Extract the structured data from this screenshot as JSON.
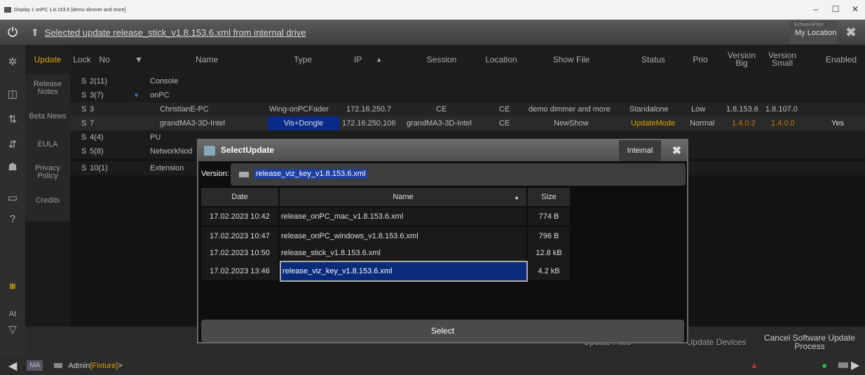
{
  "window": {
    "title": "Display 1 onPC 1.8.153.6 [demo dimmer and more]",
    "minimize": "–",
    "maximize": "☐",
    "close": "✕"
  },
  "topbar": {
    "message": "Selected update release_stick_v1.8.153.6.xml from internal drive",
    "softwarefilter_label": "SoftwareFilter",
    "softwarefilter_value": "My Location",
    "close_icon": "close-icon"
  },
  "tabs": [
    {
      "label": "Update",
      "active": true
    },
    {
      "label": "Release Notes"
    },
    {
      "label": "Beta News"
    },
    {
      "label": "EULA"
    },
    {
      "label": "Privacy Policy"
    },
    {
      "label": "Credits"
    }
  ],
  "table": {
    "headers": {
      "lock": "Lock",
      "no": "No",
      "name": "Name",
      "type": "Type",
      "ip": "IP",
      "session": "Session",
      "location": "Location",
      "showfile": "Show File",
      "status": "Status",
      "prio": "Prio",
      "version_big": "Version Big",
      "version_small": "Version Small",
      "enabled": "Enabled"
    },
    "rows": [
      {
        "lock": "S",
        "no": "2(11)",
        "name": "Console"
      },
      {
        "lock": "S",
        "no": "3(7)",
        "name": "onPC"
      },
      {
        "lock": "S",
        "no": "3",
        "name": "ChristianE-PC",
        "type": "Wing-onPCFader",
        "ip": "172.16.250.7",
        "session": "CE",
        "location": "CE",
        "showfile": "demo dimmer and more",
        "status": "Standalone",
        "prio": "Low",
        "version_big": "1.8.153.6",
        "version_small": "1.8.107.0",
        "enabled": ""
      },
      {
        "lock": "S",
        "no": "7",
        "name": "grandMA3-3D-Intel",
        "type": "Vis+Dongle",
        "ip": "172.16.250.106",
        "session": "grandMA3-3D-Intel",
        "location": "CE",
        "showfile": "NewShow",
        "status": "UpdateMode",
        "prio": "Normal",
        "version_big": "1.4.0.2",
        "version_small": "1.4.0.0",
        "enabled": "Yes"
      },
      {
        "lock": "S",
        "no": "4(4)",
        "name": "PU"
      },
      {
        "lock": "S",
        "no": "5(8)",
        "name": "NetworkNod"
      },
      {
        "lock": "S",
        "no": "10(1)",
        "name": "Extension"
      }
    ]
  },
  "bottom": {
    "update_files": "Update Files",
    "update_devices": "Update Devices",
    "cancel": "Cancel Software Update Process"
  },
  "cmdline": {
    "ma": "MA",
    "prompt_user": "Admin",
    "prompt_obj": "[Fixture]",
    "prompt_end": ">"
  },
  "sidebar": {
    "at": "At"
  },
  "dialog": {
    "title": "SelectUpdate",
    "internal": "Internal",
    "version_label": "Version:",
    "version_value": "release_viz_key_v1.8.153.6.xml",
    "headers": {
      "date": "Date",
      "name": "Name",
      "size": "Size"
    },
    "files": [
      {
        "date": "17.02.2023 10:42",
        "name": "release_onPC_mac_v1.8.153.6.xml",
        "size": "774 B"
      },
      {
        "date": "17.02.2023 10:47",
        "name": "release_onPC_windows_v1.8.153.6.xml",
        "size": "796 B"
      },
      {
        "date": "17.02.2023 10:50",
        "name": "release_stick_v1.8.153.6.xml",
        "size": "12.8 kB"
      },
      {
        "date": "17.02.2023 13:46",
        "name": "release_viz_key_v1.8.153.6.xml",
        "size": "4.2 kB",
        "selected": true
      }
    ],
    "select": "Select"
  },
  "colors": {
    "accent": "#d8a400",
    "selection": "#0a2a7a",
    "status_update": "#d8a400",
    "version_old": "#c87a00"
  }
}
